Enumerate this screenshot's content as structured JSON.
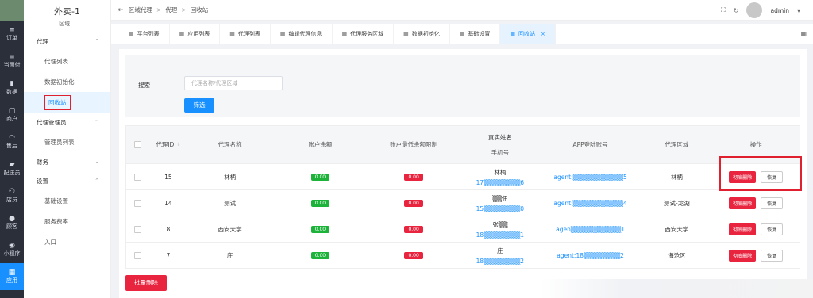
{
  "rail": [
    {
      "icon": "order-icon",
      "glyph": "≡",
      "label": "订单"
    },
    {
      "icon": "pay-icon",
      "glyph": "≡",
      "label": "当面付"
    },
    {
      "icon": "chart-icon",
      "glyph": "▮",
      "label": "数据"
    },
    {
      "icon": "shop-icon",
      "glyph": "▢",
      "label": "商户"
    },
    {
      "icon": "headset-icon",
      "glyph": "◠",
      "label": "售后"
    },
    {
      "icon": "delivery-icon",
      "glyph": "▰",
      "label": "配送员"
    },
    {
      "icon": "store-icon",
      "glyph": "⚇",
      "label": "店员"
    },
    {
      "icon": "customer-icon",
      "glyph": "●",
      "label": "顾客"
    },
    {
      "icon": "miniapp-icon",
      "glyph": "◉",
      "label": "小程序"
    },
    {
      "icon": "app-icon",
      "glyph": "▦",
      "label": "应用"
    }
  ],
  "sidebar": {
    "title": "外卖-1",
    "subtitle": "区域...",
    "groups": [
      {
        "label": "代理",
        "chev": "⌃"
      },
      {
        "label": "代理管理员",
        "chev": "⌃"
      },
      {
        "label": "财务",
        "chev": "⌄"
      },
      {
        "label": "设置",
        "chev": "⌃"
      }
    ],
    "items": [
      "代理列表",
      "数据初始化",
      "回收站",
      "管理员列表",
      "基础设置",
      "服务费率",
      "入口"
    ]
  },
  "header": {
    "crumbs": [
      "区域代理",
      "代理",
      "回收站"
    ],
    "user": "admin"
  },
  "tabs": [
    "平台列表",
    "应用列表",
    "代理列表",
    "编辑代理信息",
    "代理服务区域",
    "数据初始化",
    "基础设置",
    "回收站"
  ],
  "search": {
    "label": "搜索",
    "placeholder": "代理名称/代理区域",
    "button": "筛选"
  },
  "table": {
    "headers": {
      "id": "代理ID",
      "name": "代理名称",
      "balance": "账户余额",
      "min_limit": "账户最低余额限制",
      "real_name": "真实姓名",
      "phone": "手机号",
      "app_account": "APP登陆账号",
      "area": "代理区域",
      "ops": "操作"
    },
    "rows": [
      {
        "id": "15",
        "name": "林柄",
        "balance": "0.00",
        "limit": "0.00",
        "real": "林柄",
        "phone": "17▒▒▒▒▒▒▒▒6",
        "app": "agent:▒▒▒▒▒▒▒▒▒▒▒5",
        "area": "林柄"
      },
      {
        "id": "14",
        "name": "测试",
        "balance": "0.00",
        "limit": "0.00",
        "real": "▒▒佃",
        "phone": "15▒▒▒▒▒▒▒▒0",
        "app": "agent:▒▒▒▒▒▒▒▒▒▒▒4",
        "area": "测试-龙湖"
      },
      {
        "id": "8",
        "name": "西安大学",
        "balance": "0.00",
        "limit": "0.00",
        "real": "张▒▒",
        "phone": "18▒▒▒▒▒▒▒▒1",
        "app": "agen▒▒▒▒▒▒▒▒▒▒▒1",
        "area": "西安大学"
      },
      {
        "id": "7",
        "name": "庄",
        "balance": "0.00",
        "limit": "0.00",
        "real": "庄",
        "phone": "18▒▒▒▒▒▒▒▒2",
        "app": "agent:18▒▒▒▒▒▒▒▒2",
        "area": "海沧区"
      }
    ],
    "delete_label": "彻底删除",
    "restore_label": "恢复"
  },
  "bulk_delete": "批量删除",
  "colors": {
    "primary": "#1890ff",
    "danger": "#e8243f",
    "success": "#1db33b",
    "rail": "#2b2f3a"
  }
}
